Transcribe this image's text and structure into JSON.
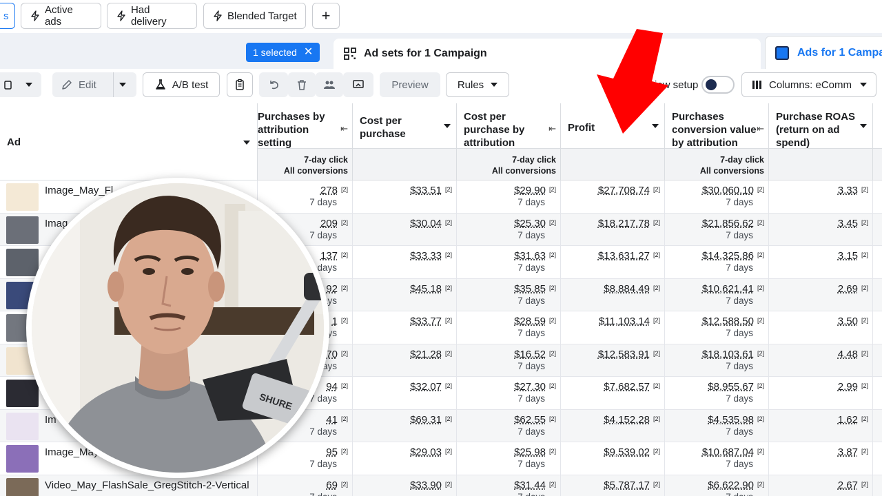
{
  "filters": {
    "chips": [
      "Active ads",
      "Had delivery",
      "Blended Target"
    ],
    "first_chip_fragment": "s",
    "add_label": "+"
  },
  "tabs": {
    "selected_badge": "1 selected",
    "adsets_label": "Ad sets for 1 Campaign",
    "ads_label": "Ads for 1 Campa"
  },
  "toolbar": {
    "edit_label": "Edit",
    "ab_test_label": "A/B test",
    "preview_label": "Preview",
    "rules_label": "Rules",
    "view_setup_label": "iew setup",
    "columns_label": "Columns: eComm"
  },
  "table": {
    "ad_header": "Ad",
    "columns": [
      {
        "header": "Purchases by attribution setting",
        "sub1": "7-day click",
        "sub2": "All conversions"
      },
      {
        "header": "Cost per purchase",
        "sub1": "",
        "sub2": ""
      },
      {
        "header": "Cost per purchase by attribution setting",
        "sub1": "7-day click",
        "sub2": "All conversions"
      },
      {
        "header": "Profit",
        "sub1": "",
        "sub2": ""
      },
      {
        "header": "Purchases conversion value by attribution setting",
        "sub1": "7-day click",
        "sub2": "All conversions"
      },
      {
        "header": "Purchase ROAS (return on ad spend)",
        "sub1": "",
        "sub2": ""
      }
    ],
    "note_mark": "[2]",
    "days_label": "7 days",
    "rows": [
      {
        "name": "Image_May_Fl",
        "purchases": "278",
        "cpp": "$33.51",
        "cpp_attr": "$29.90",
        "profit": "$27,708.74",
        "value": "$30,060.10",
        "roas": "3.33",
        "thumb": "#f4e9d6"
      },
      {
        "name": "Imag",
        "purchases": "209",
        "cpp": "$30.04",
        "cpp_attr": "$25.30",
        "profit": "$18,217.78",
        "value": "$21,856.62",
        "roas": "3.45",
        "thumb": "#6b6f78"
      },
      {
        "name": "",
        "purchases": "137",
        "cpp": "$33.33",
        "cpp_attr": "$31.63",
        "profit": "$13,631.27",
        "value": "$14,325.86",
        "roas": "3.15",
        "thumb": "#5d626b"
      },
      {
        "name": "",
        "purchases": "92",
        "cpp": "$45.18",
        "cpp_attr": "$35.85",
        "profit": "$8,884.49",
        "value": "$10,621.41",
        "roas": "2.69",
        "thumb": "#3a4a7a"
      },
      {
        "name": "",
        "purchases": "1",
        "cpp": "$33.77",
        "cpp_attr": "$28.59",
        "profit": "$11,103.14",
        "value": "$12,588.50",
        "roas": "3.50",
        "thumb": "#73777f"
      },
      {
        "name": "",
        "purchases": "70",
        "cpp": "$21.28",
        "cpp_attr": "$16.52",
        "profit": "$12,583.91",
        "value": "$18,103.61",
        "roas": "4.48",
        "thumb": "#f1e4cf"
      },
      {
        "name": "",
        "purchases": "94",
        "cpp": "$32.07",
        "cpp_attr": "$27.30",
        "profit": "$7,682.57",
        "value": "$8,955.67",
        "roas": "2.99",
        "thumb": "#2b2b33"
      },
      {
        "name": "Im",
        "purchases": "41",
        "cpp": "$69.31",
        "cpp_attr": "$62.55",
        "profit": "$4,152.28",
        "value": "$4,535.98",
        "roas": "1.62",
        "thumb": "#eae3f1"
      },
      {
        "name": "Image_May",
        "purchases": "95",
        "cpp": "$29.03",
        "cpp_attr": "$25.98",
        "profit": "$9,539.02",
        "value": "$10,687.04",
        "roas": "3.87",
        "thumb": "#8b6fb8"
      },
      {
        "name": "Video_May_FlashSale_GregStitch-2-Vertical",
        "purchases": "69",
        "cpp": "$33.90",
        "cpp_attr": "$31.44",
        "profit": "$5,787.17",
        "value": "$6,622.90",
        "roas": "2.67",
        "thumb": "#7b6a58"
      }
    ]
  },
  "overlay": {
    "mic_brand": "SHURE",
    "arrow_color": "#ff0000"
  }
}
